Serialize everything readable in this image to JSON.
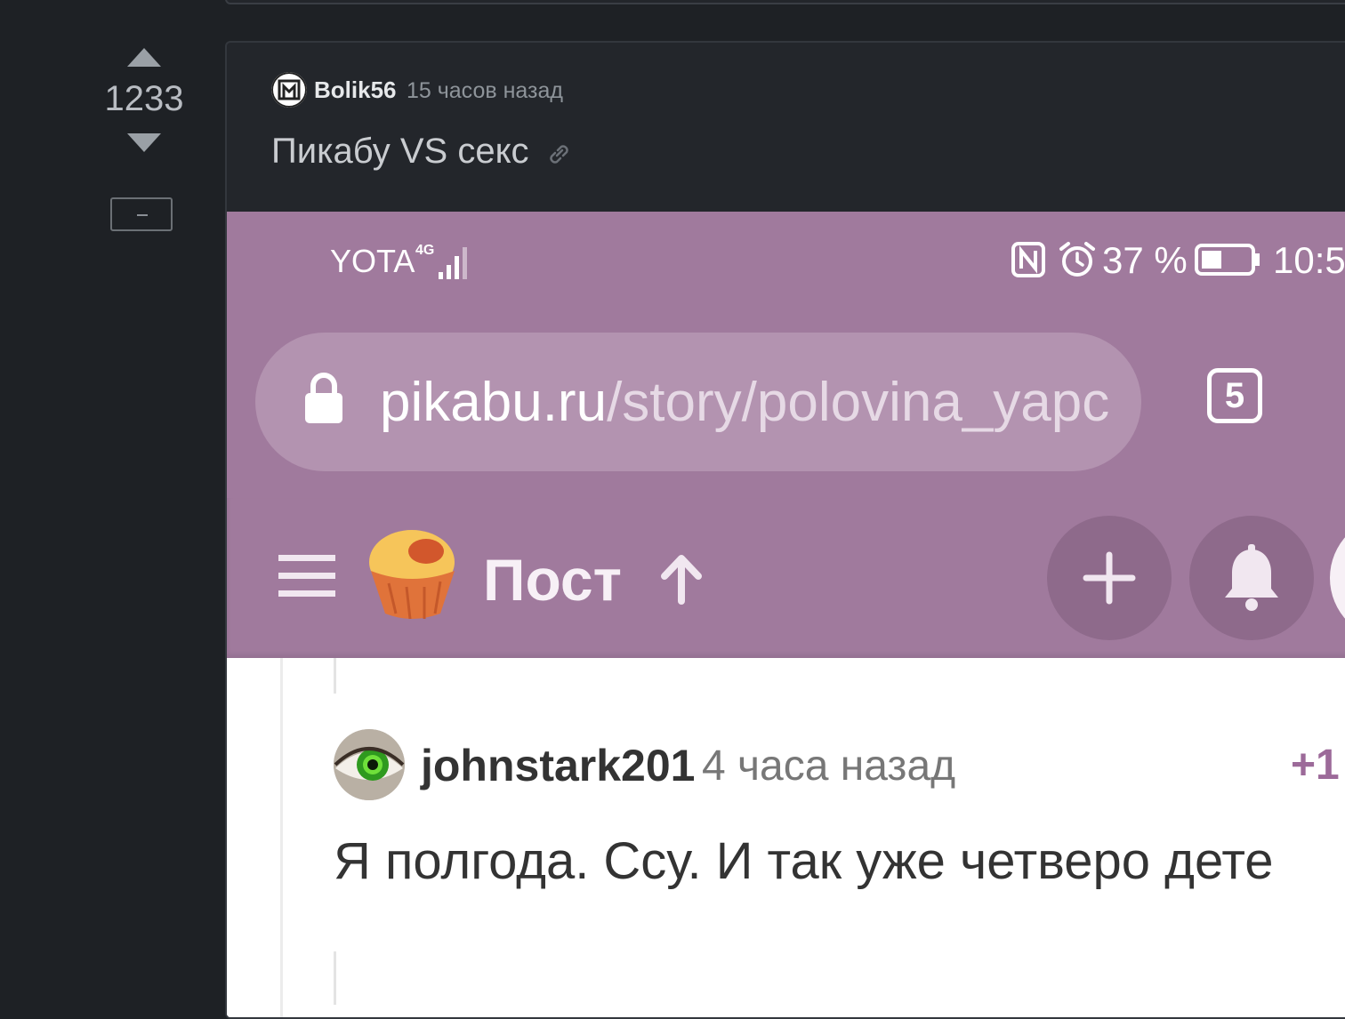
{
  "rating": {
    "value": "1233"
  },
  "post": {
    "author": "Bolik56",
    "time": "15 часов назад",
    "title": "Пикабу VS секс"
  },
  "screenshot": {
    "status_bar": {
      "carrier": "YOTA",
      "battery": "37 %",
      "clock": "10:5"
    },
    "address_bar": {
      "url_host": "pikabu.ru",
      "url_path": "/story/polovina_yapc",
      "tabs_count": "5"
    },
    "nav": {
      "title": "Пост"
    },
    "comment": {
      "author": "johnstark201",
      "time": "4 часа назад",
      "rating": "+1",
      "text": "Я полгода. Ссу. И так уже четверо дете"
    }
  },
  "colors": {
    "page_bg": "#1e2125",
    "card_bg": "#23262b",
    "pikabu_purple": "#a07a9d",
    "url_pill": "#b393b0",
    "comment_rating": "#9c6a99"
  }
}
